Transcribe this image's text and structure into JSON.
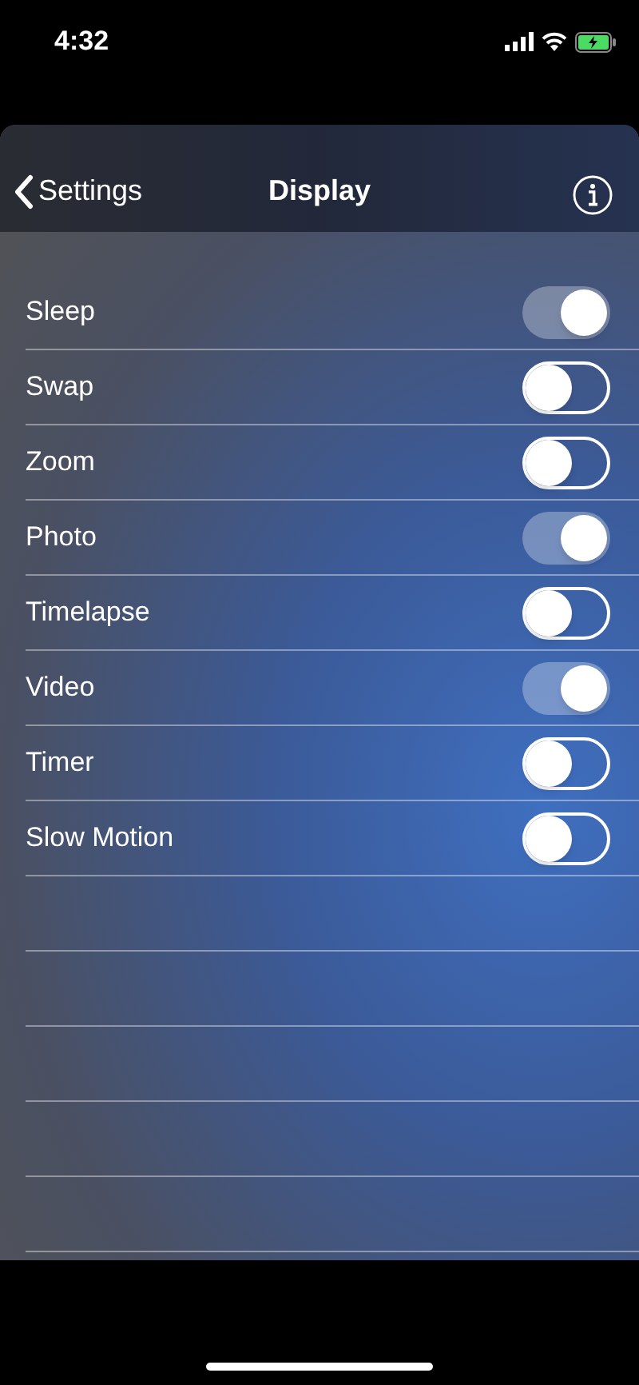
{
  "status_bar": {
    "time": "4:32"
  },
  "nav_bar": {
    "back": "Settings",
    "title": "Display"
  },
  "settings": [
    {
      "label": "Sleep",
      "on": true
    },
    {
      "label": "Swap",
      "on": false
    },
    {
      "label": "Zoom",
      "on": false
    },
    {
      "label": "Photo",
      "on": true
    },
    {
      "label": "Timelapse",
      "on": false
    },
    {
      "label": "Video",
      "on": true
    },
    {
      "label": "Timer",
      "on": false
    },
    {
      "label": "Slow Motion",
      "on": false
    }
  ]
}
